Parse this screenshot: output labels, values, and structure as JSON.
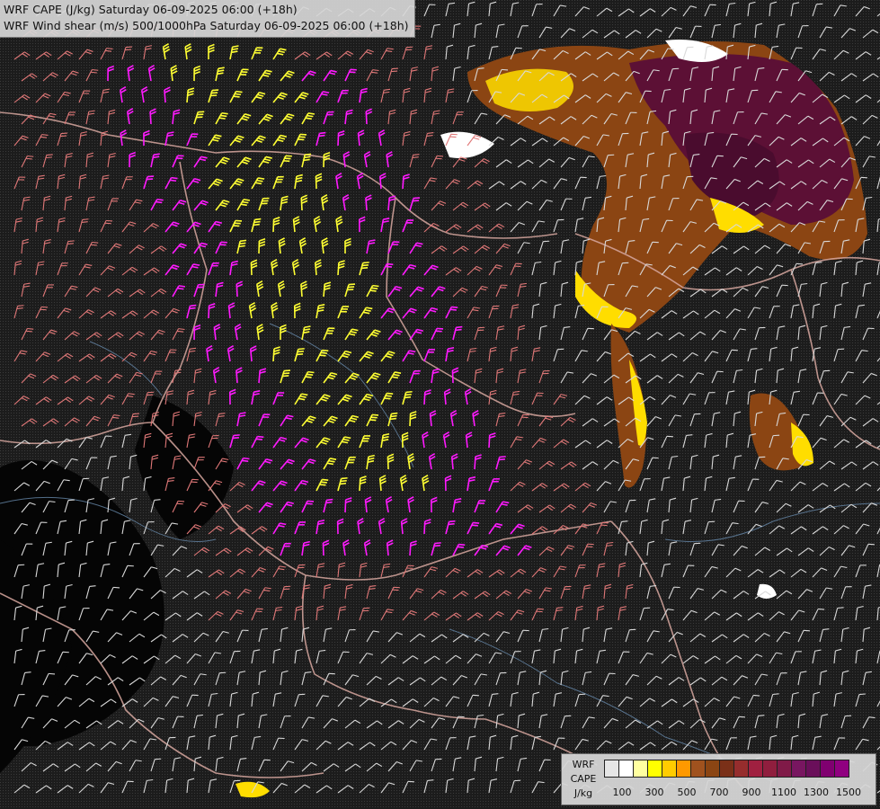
{
  "title": {
    "line1": "WRF CAPE (J/kg) Saturday 06-09-2025 06:00 (+18h)",
    "line2": "WRF Wind shear (m/s) 500/1000hPa Saturday 06-09-2025 06:00 (+18h)"
  },
  "legend": {
    "label_line1": "WRF",
    "label_line2": "CAPE",
    "label_line3": "J/kg",
    "ticks": [
      "100",
      "300",
      "500",
      "700",
      "900",
      "1100",
      "1300",
      "1500"
    ],
    "colors": [
      "#e6e6e6",
      "#ffffff",
      "#ffffa0",
      "#ffff00",
      "#ffcc00",
      "#ff9900",
      "#a0521e",
      "#8b4513",
      "#7a3018",
      "#962d2d",
      "#a02040",
      "#901e3e",
      "#801a48",
      "#781660",
      "#6a0f5a",
      "#800070",
      "#900080"
    ]
  },
  "colors": {
    "background": "#1c1c1c",
    "barb_weak": "#d9d9d9",
    "barb_moderate": "#e07878",
    "barb_strong": "#ffff33",
    "barb_very_strong": "#ff1aff",
    "border": "#d8a8a0",
    "river": "#6688aa",
    "cape_low": "#ffff00",
    "cape_mid": "#8b4513",
    "cape_high": "#6a1040"
  }
}
